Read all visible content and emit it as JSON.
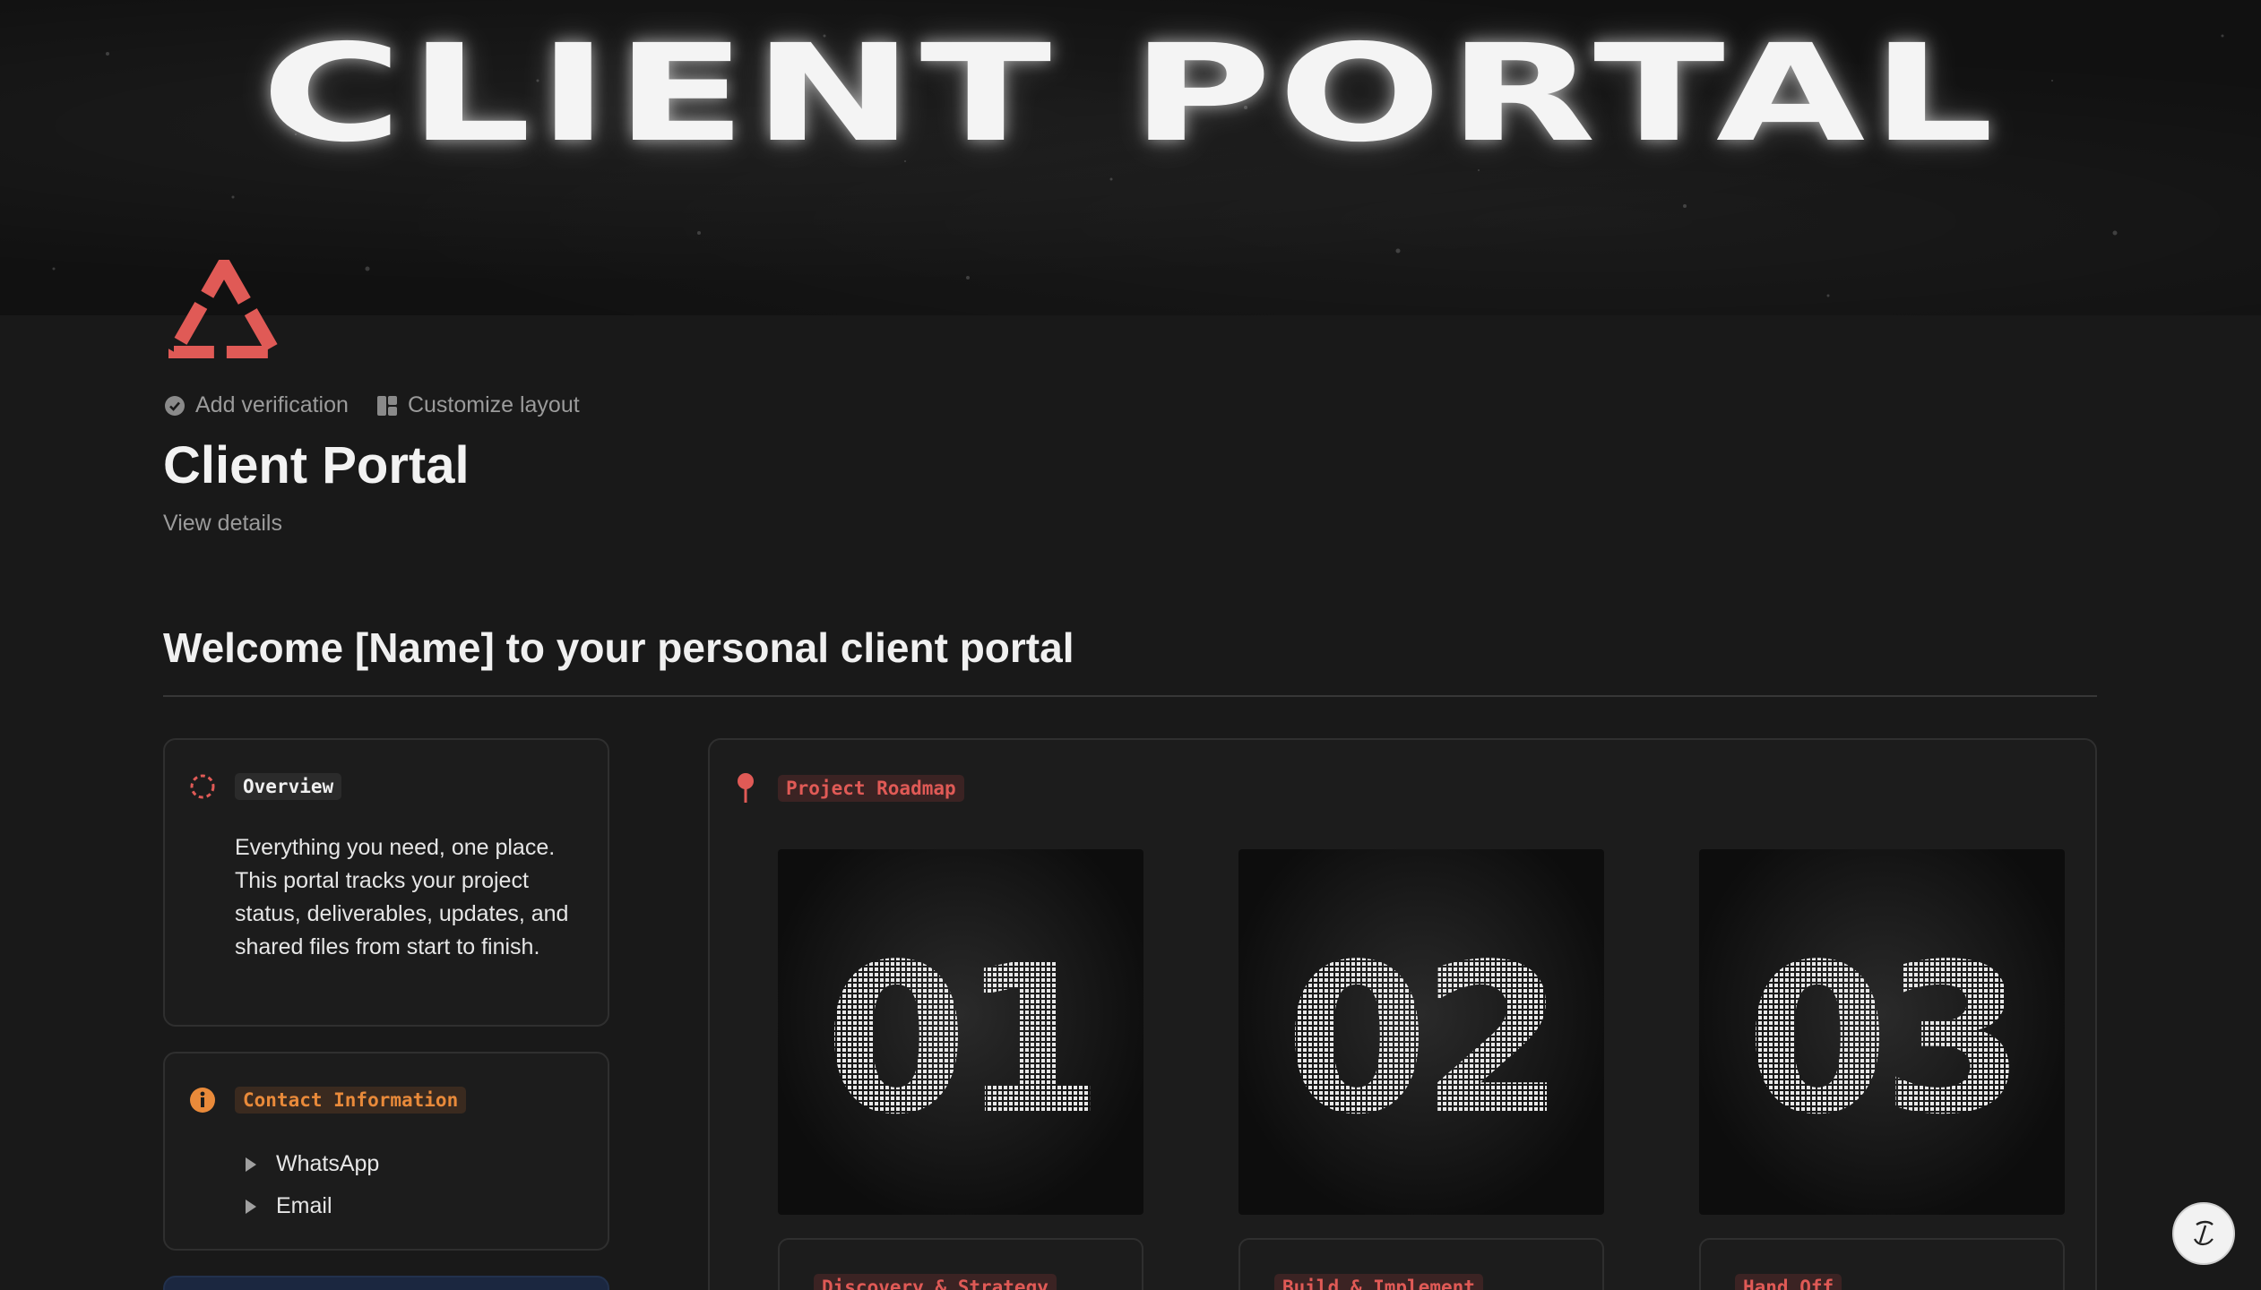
{
  "cover": {
    "title": "CLIENT PORTAL"
  },
  "header": {
    "add_verification": "Add verification",
    "customize_layout": "Customize layout",
    "title": "Client Portal",
    "view_details": "View details"
  },
  "welcome_heading": "Welcome [Name] to your personal client portal",
  "overview": {
    "label": "Overview",
    "text": "Everything you need, one place. This portal tracks your project status, deliverables, updates, and shared files from start to finish."
  },
  "contact": {
    "label": "Contact Information",
    "items": [
      "WhatsApp",
      "Email"
    ]
  },
  "roadmap": {
    "label": "Project Roadmap",
    "steps": [
      {
        "number": "01",
        "phase": "Discovery & Strategy"
      },
      {
        "number": "02",
        "phase": "Build & Implement"
      },
      {
        "number": "03",
        "phase": "Hand Off"
      }
    ]
  },
  "colors": {
    "accent_red": "#e05a56",
    "accent_orange": "#e98a3a",
    "background": "#191919"
  }
}
